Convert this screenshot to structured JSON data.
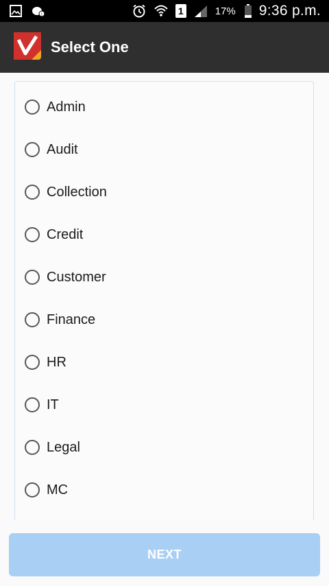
{
  "status_bar": {
    "battery_percent": "17%",
    "time": "9:36 p.m.",
    "sim_slot": "1",
    "icons": [
      "gallery-icon",
      "weather-icon",
      "alarm-icon",
      "wifi-icon",
      "sim-icon",
      "signal-icon",
      "battery-icon"
    ]
  },
  "app_bar": {
    "title": "Select One",
    "logo_colors": {
      "red": "#d0312d",
      "orange": "#f2a527"
    }
  },
  "options": [
    {
      "label": "Admin"
    },
    {
      "label": "Audit"
    },
    {
      "label": "Collection"
    },
    {
      "label": "Credit"
    },
    {
      "label": "Customer"
    },
    {
      "label": "Finance"
    },
    {
      "label": "HR"
    },
    {
      "label": "IT"
    },
    {
      "label": "Legal"
    },
    {
      "label": "MC"
    }
  ],
  "footer": {
    "next_label": "NEXT",
    "button_color": "#a9cff5"
  }
}
